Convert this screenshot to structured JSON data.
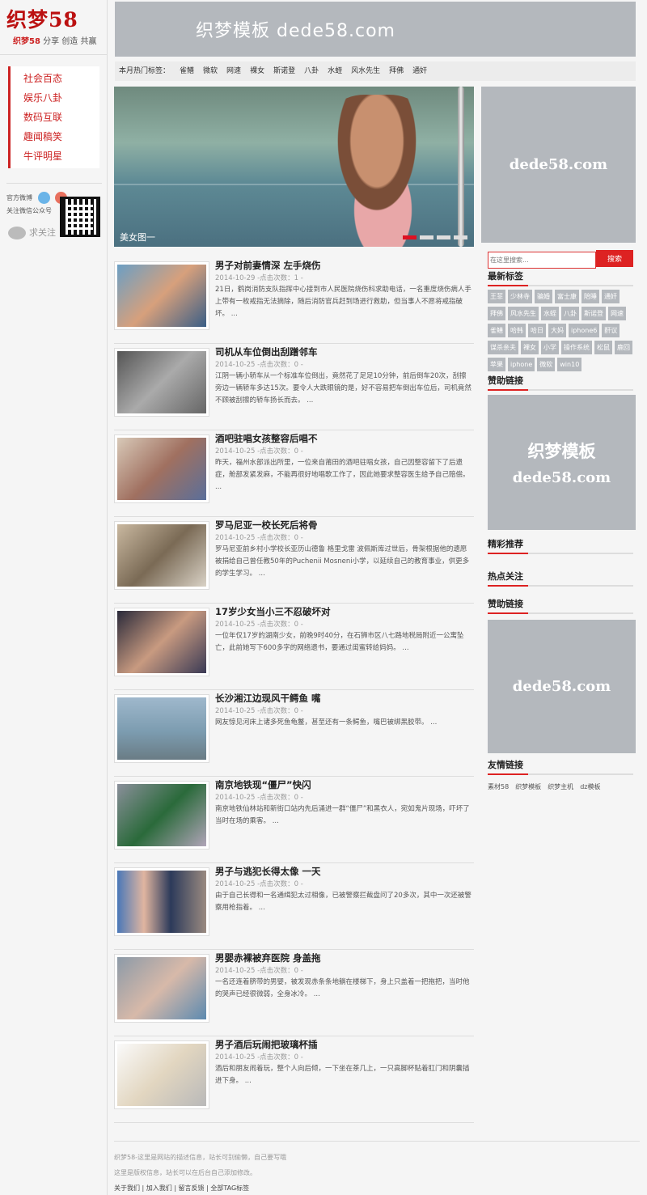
{
  "site": {
    "logo": "织梦58",
    "slogan_brand": "织梦58",
    "slogan": " 分享 创造 共赢"
  },
  "nav": [
    "社会百态",
    "娱乐八卦",
    "数码互联",
    "趣闻稿笑",
    "牛评明星"
  ],
  "social": {
    "weibo_label": "官方微博",
    "wechat_label": "关注微信公众号",
    "follow_text": "求关注"
  },
  "banner": {
    "text": "织梦模板 dede58.com"
  },
  "hot_tags": {
    "label": "本月热门标签：",
    "items": [
      "雀鳝",
      "微软",
      "网速",
      "裸女",
      "斯诺登",
      "八卦",
      "水蛭",
      "风水先生",
      "拜佛",
      "通奸"
    ]
  },
  "slider": {
    "caption": "美女图一",
    "dots": 4,
    "active": 0
  },
  "articles": [
    {
      "title": "男子对前妻情深 左手烧伤",
      "date": "2014-10-29",
      "views": " -点击次数：1 -",
      "desc": "21日，鹤岗消防支队指挥中心接到市人民医院烧伤科求助电话，一名重度烧伤病人手上带有一枚戒指无法摘除，随后消防官兵赶到场进行救助，但当事人不愿将戒指破坏。 ..."
    },
    {
      "title": "司机从车位倒出刮蹭邻车",
      "date": "2014-10-25",
      "views": " -点击次数：0 -",
      "desc": "江阴一辆小轿车从一个标准车位倒出，竟然花了足足10分钟，前后倒车20次，刮擦旁边一辆轿车多达15次。要令人大跌眼镜的是，好不容易把车倒出车位后，司机竟然不顾被刮擦的轿车扬长而去。 ..."
    },
    {
      "title": "酒吧驻唱女孩整容后唱不",
      "date": "2014-10-25",
      "views": " -点击次数：0 -",
      "desc": "昨天，福州水部派出所里，一位来自莆田的酒吧驻唱女孩，自己因整容留下了后遗症，舱部发紧发麻，不能再很好地唱歌工作了，因此她要求整容医生给予自己赔偿。 ..."
    },
    {
      "title": "罗马尼亚一校长死后将骨",
      "date": "2014-10-25",
      "views": " -点击次数：0 -",
      "desc": "罗马尼亚前乡村小学校长亚历山德鲁 格里戈雷 波佩斯库过世后，骨架根据他的遗愿被捐给自己曾任教50年的Puchenii Mosneni小学，以延续自己的教育事业，供更多的学生学习。 ..."
    },
    {
      "title": "17岁少女当小三不忍破坏对",
      "date": "2014-10-25",
      "views": " -点击次数：0 -",
      "desc": "一位年仅17岁的湖南少女，前晚9时40分，在石狮市区八七路地税局附近一公寓坠亡，此前她写下600多字的网络遗书，要通过闺蜜转给妈妈。 ..."
    },
    {
      "title": "长沙湘江边现风干鳄鱼 嘴",
      "date": "2014-10-25",
      "views": " -点击次数：0 -",
      "desc": "网友惊见河床上诸多死鱼龟鳖，甚至还有一条鳄鱼，嘴巴被绑黑胶带。 ..."
    },
    {
      "title": "南京地铁现“僵尸”快闪",
      "date": "2014-10-25",
      "views": " -点击次数：0 -",
      "desc": "南京地铁仙林站和新街口站内先后涌进一群“僵尸”和黑衣人，宛如鬼片现场，吓坏了当时在场的乘客。 ..."
    },
    {
      "title": "男子与逃犯长得太像 一天",
      "date": "2014-10-25",
      "views": " -点击次数：0 -",
      "desc": "由于自己长得和一名通缉犯太过相像，已被警察拦截盘问了20多次，其中一次还被警察用枪指着。 ..."
    },
    {
      "title": "男婴赤裸被弃医院 身盖拖",
      "date": "2014-10-25",
      "views": " -点击次数：0 -",
      "desc": "一名还连着脐带的男婴，被发现赤条条地躺在楼梯下，身上只盖着一把拖把，当时他的哭声已经很微弱，全身冰冷。 ..."
    },
    {
      "title": "男子酒后玩闹把玻璃杯插",
      "date": "2014-10-25",
      "views": " -点击次数：0 -",
      "desc": "酒后和朋友闹着玩，整个人向后倾，一下坐在茶几上，一只高脚杯贴着肛门和阴囊插进下身。 ..."
    }
  ],
  "right": {
    "ad1": "dede58.com",
    "search_placeholder": "在这里搜索...",
    "search_button": "搜索",
    "latest_tags_title": "最新标签",
    "latest_tags": [
      "王菲",
      "少林寺",
      "骗婚",
      "富士康",
      "陪睡",
      "通奸",
      "拜佛",
      "风水先生",
      "水蛭",
      "八卦",
      "斯诺登",
      "网速",
      "雀鳝",
      "哈韩",
      "哈日",
      "大妈",
      "iphone6",
      "酐议",
      "谋杀亲夫",
      "裸女",
      "小学",
      "操作系统",
      "松鼠",
      "鹿回",
      "苹果",
      "iphone",
      "微软",
      "win10"
    ],
    "sponsor_title": "赞助链接",
    "ad2_line1": "织梦模板",
    "ad2_line2": "dede58.com",
    "recommend_title": "精彩推荐",
    "hot_title": "热点关注",
    "sponsor2_title": "赞助链接",
    "ad3": "dede58.com",
    "friend_title": "友情链接",
    "friend_links": [
      "素材58",
      "织梦模板",
      "织梦主机",
      "dz模板"
    ]
  },
  "footer": {
    "line1": "织梦58-这里是网站的描述信息，站长可别偷懒，自己要写哦",
    "line2": "这里是版权信息，站长可以在后台自己添加修改。",
    "links": "关于我们 | 加入我们 | 留言反馈 | 全部TAG标签"
  }
}
